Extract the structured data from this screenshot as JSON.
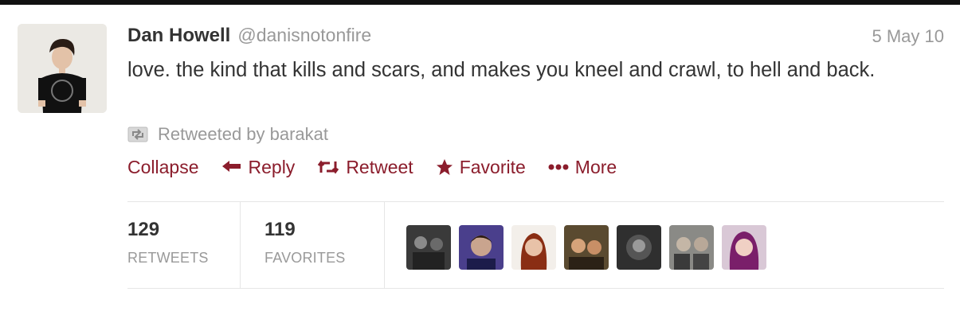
{
  "tweet": {
    "author_name": "Dan Howell",
    "handle": "@danisnotonfire",
    "date": "5 May 10",
    "text": "love. the kind that kills and scars, and makes you kneel and crawl, to hell and back.",
    "retweeted_by": "Retweeted by barakat"
  },
  "actions": {
    "collapse": "Collapse",
    "reply": "Reply",
    "retweet": "Retweet",
    "favorite": "Favorite",
    "more": "More"
  },
  "stats": {
    "retweets_count": "129",
    "retweets_label": "RETWEETS",
    "favorites_count": "119",
    "favorites_label": "FAVORITES"
  },
  "colors": {
    "action": "#8b1d2c",
    "text": "#333333",
    "muted": "#999999"
  },
  "icons": {
    "retweeted": "retweet-icon",
    "reply": "reply-arrow-icon",
    "retweet": "retweet-arrows-icon",
    "favorite": "star-icon",
    "more": "more-dots-icon"
  }
}
